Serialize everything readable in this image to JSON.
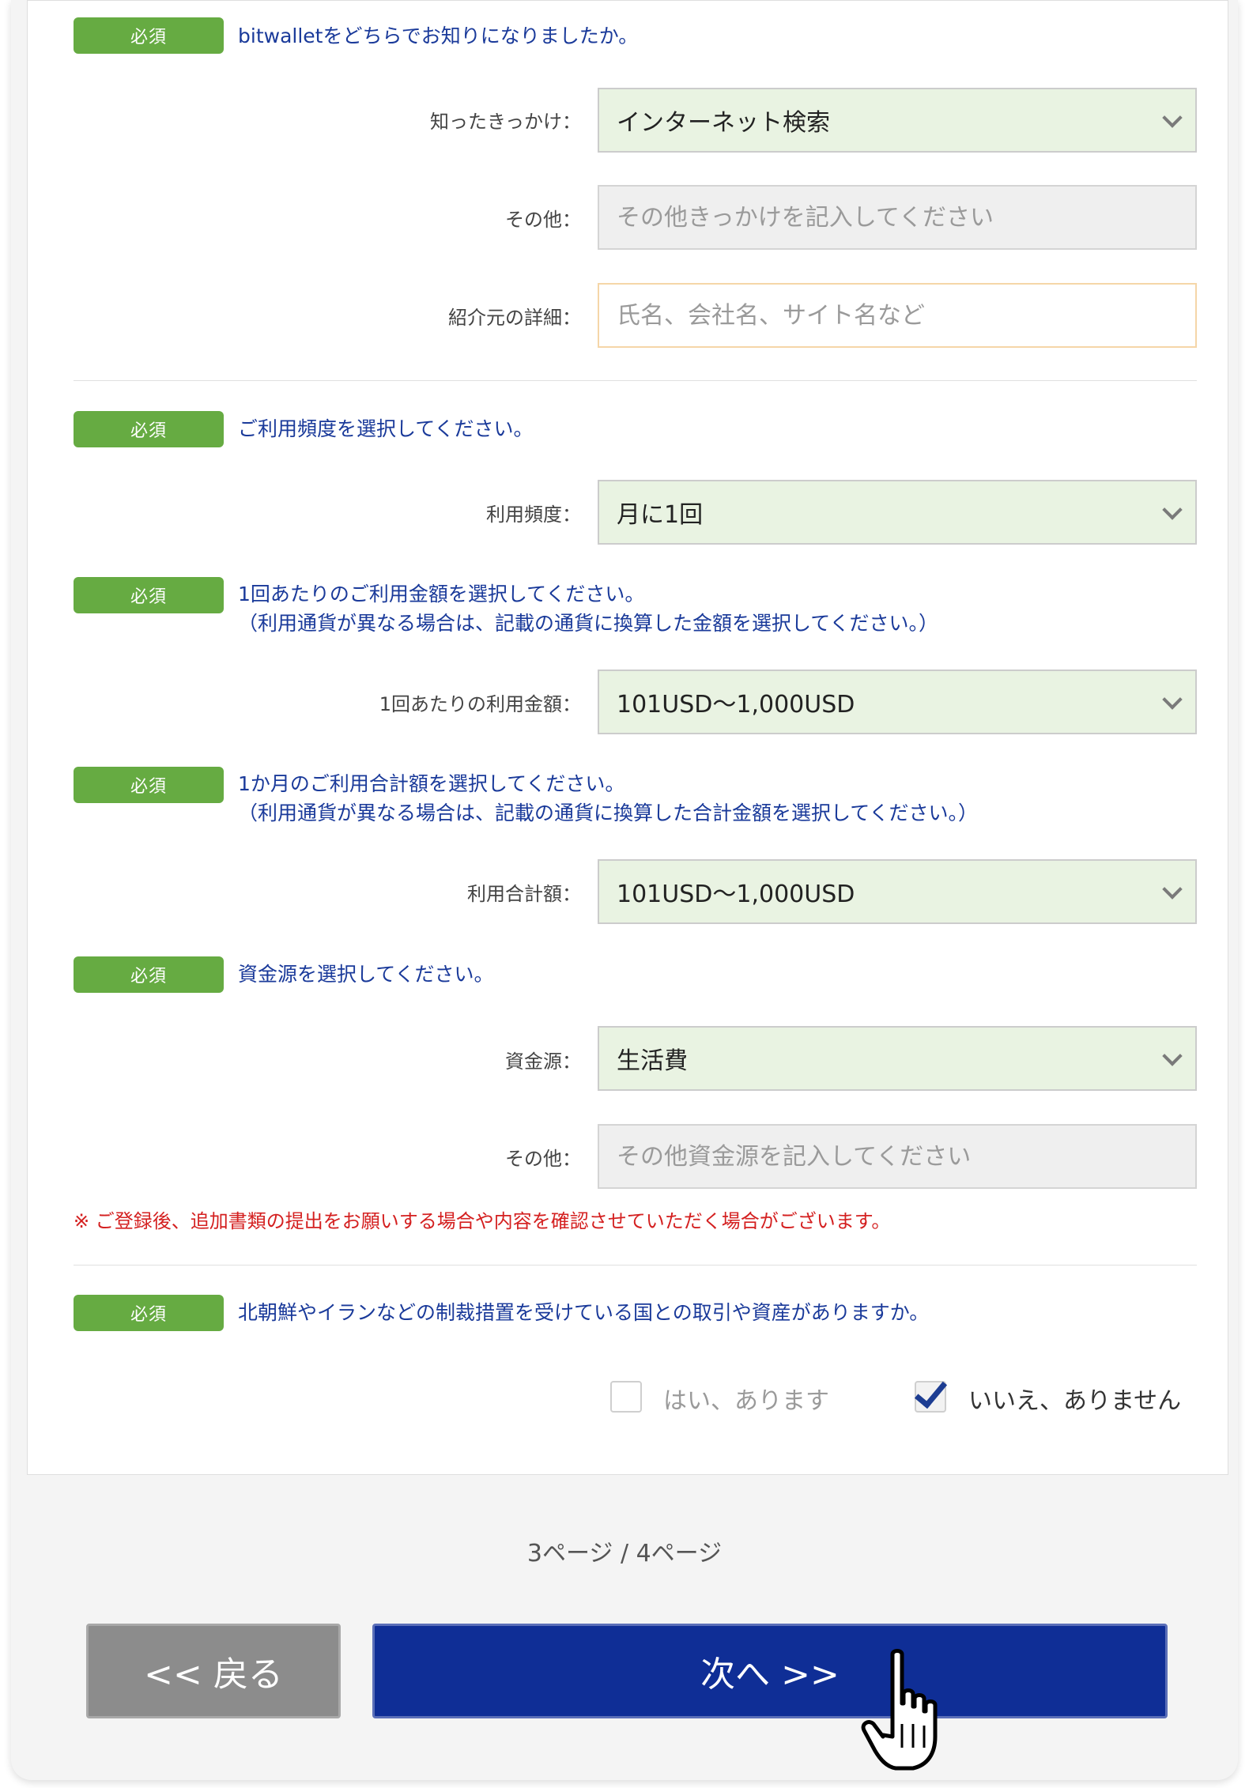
{
  "q1": {
    "badge": "必須",
    "question": "bitwalletをどちらでお知りになりましたか。",
    "source_label": "知ったきっかけ：",
    "source_value": "インターネット検索",
    "other_label": "その他：",
    "other_placeholder": "その他きっかけを記入してください",
    "referrer_label": "紹介元の詳細：",
    "referrer_placeholder": "氏名、会社名、サイト名など"
  },
  "q2": {
    "badge": "必須",
    "question": "ご利用頻度を選択してください。",
    "freq_label": "利用頻度：",
    "freq_value": "月に1回"
  },
  "q3": {
    "badge": "必須",
    "question": "1回あたりのご利用金額を選択してください。\n（利用通貨が異なる場合は、記載の通貨に換算した金額を選択してください。）",
    "amount_label": "1回あたりの利用金額：",
    "amount_value": "101USD〜1,000USD"
  },
  "q4": {
    "badge": "必須",
    "question": "1か月のご利用合計額を選択してください。\n（利用通貨が異なる場合は、記載の通貨に換算した合計金額を選択してください。）",
    "total_label": "利用合計額：",
    "total_value": "101USD〜1,000USD"
  },
  "q5": {
    "badge": "必須",
    "question": "資金源を選択してください。",
    "funds_label": "資金源：",
    "funds_value": "生活費",
    "other_label": "その他：",
    "other_placeholder": "その他資金源を記入してください",
    "note": "※ ご登録後、追加書類の提出をお願いする場合や内容を確認させていただく場合がございます。"
  },
  "q6": {
    "badge": "必須",
    "question": "北朝鮮やイランなどの制裁措置を受けている国との取引や資産がありますか。",
    "yes_label": "はい、あります",
    "no_label": "いいえ、ありません"
  },
  "pager": "3ページ / 4ページ",
  "nav": {
    "back_label": "<< 戻る",
    "next_label": "次へ >>"
  },
  "colors": {
    "badge": "#66ab42",
    "question_text": "#1a3a9a",
    "select_bg": "#e9f3e2",
    "note": "#d42020",
    "next_button": "#0f2e96",
    "back_button": "#8c8c8c"
  },
  "icons": [
    "chevron-down-icon",
    "checkmark-icon",
    "hand-pointer-icon"
  ]
}
